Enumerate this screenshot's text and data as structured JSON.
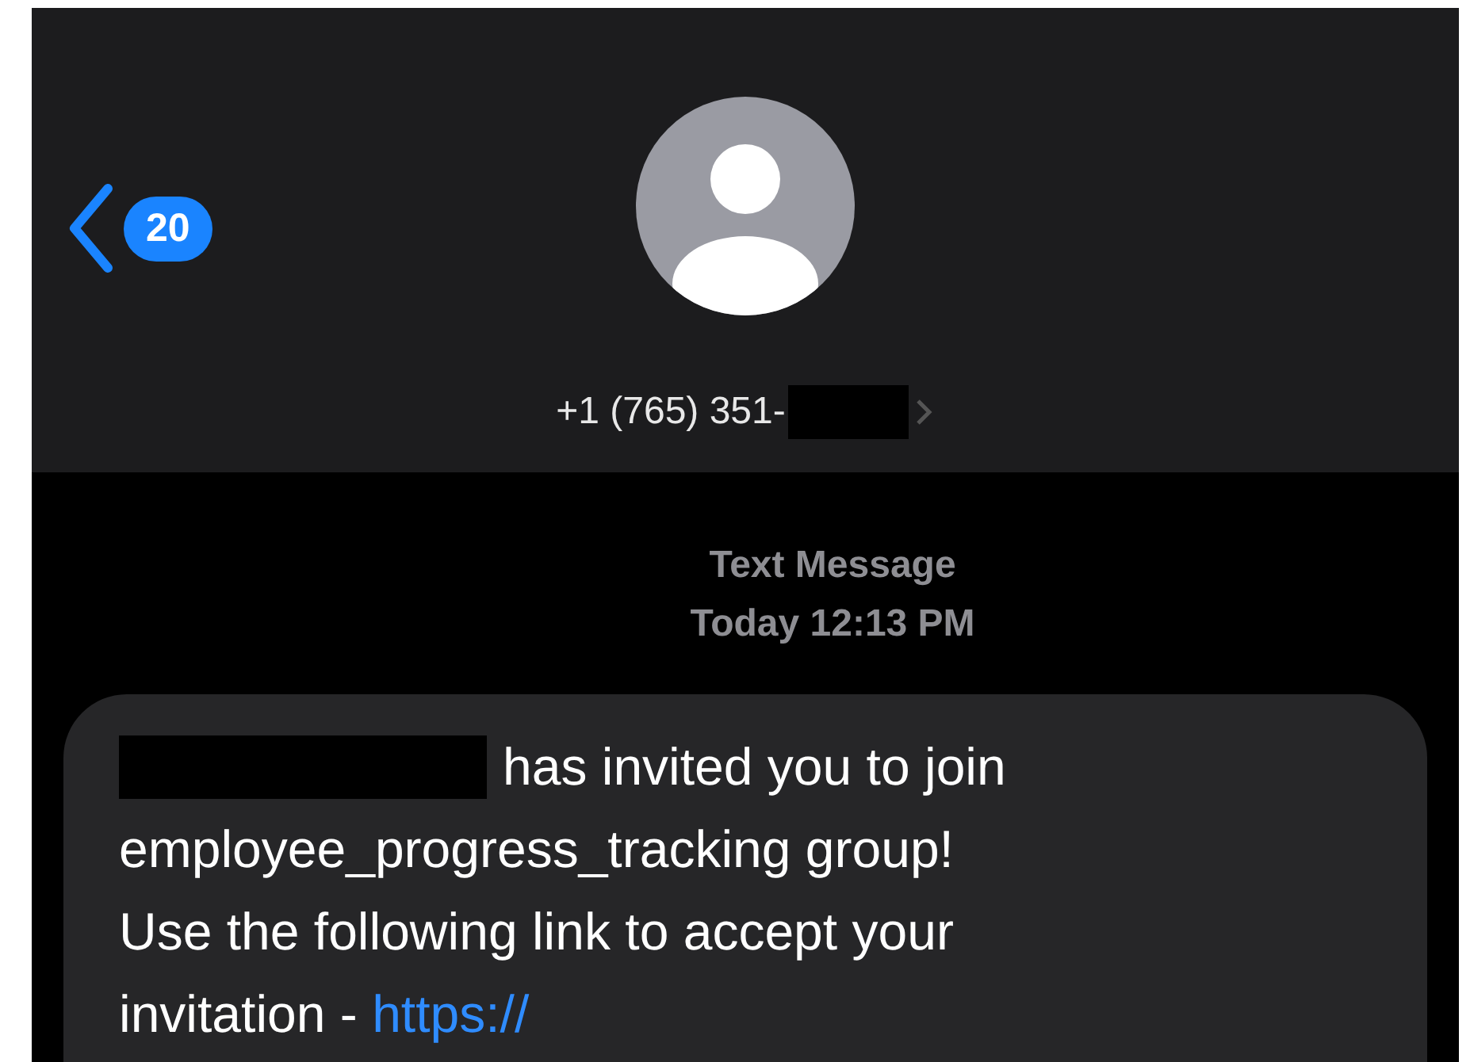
{
  "header": {
    "unread_count": "20",
    "contact": "+1 (765) 351-"
  },
  "thread": {
    "service": "Text Message",
    "timestamp": "Today 12:13 PM"
  },
  "message": {
    "lead": "has invited you to join",
    "lines": [
      "employee_progress_tracking group!",
      "Use the following link to accept your",
      "invitation -"
    ],
    "link": "https://"
  }
}
